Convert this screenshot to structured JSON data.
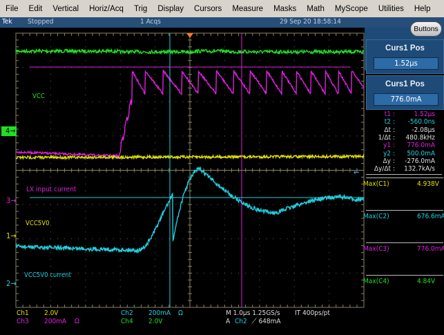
{
  "menu": [
    "File",
    "Edit",
    "Vertical",
    "Horiz/Acq",
    "Trig",
    "Display",
    "Cursors",
    "Measure",
    "Masks",
    "Math",
    "MyScope",
    "Utilities",
    "Help"
  ],
  "status": {
    "brand": "Tek",
    "state": "Stopped",
    "acqs": "1 Acqs",
    "datetime": "29 Sep 20 18:58:14"
  },
  "buttons_label": "Buttons",
  "cursor_panels": [
    {
      "title": "Curs1 Pos",
      "value": "1.52µs"
    },
    {
      "title": "Curs1 Pos",
      "value": "776.0mA"
    }
  ],
  "readouts": [
    {
      "key": "t1",
      "value": "1.52µs",
      "color": "#e020e0"
    },
    {
      "key": "t2",
      "value": "-560.0ns",
      "color": "#20d0e0"
    },
    {
      "key": "Δt",
      "value": "-2.08µs",
      "color": "#e0e0e0"
    },
    {
      "key": "1/Δt",
      "value": "480.8kHz",
      "color": "#e0e0e0"
    },
    {
      "key": "y1",
      "value": "776.0mA",
      "color": "#e020e0"
    },
    {
      "key": "y2",
      "value": "500.0mA",
      "color": "#20d0e0"
    },
    {
      "key": "Δy",
      "value": "-276.0mA",
      "color": "#e0e0e0"
    },
    {
      "key": "Δy/Δt",
      "value": "132.7kA/s",
      "color": "#e0e0e0"
    }
  ],
  "measurements": [
    {
      "label": "Max(C1)",
      "value": "4.938V",
      "color": "#e0e000"
    },
    {
      "label": "Max(C2)",
      "value": "676.6mA",
      "color": "#20d0e0"
    },
    {
      "label": "Max(C3)",
      "value": "776.0mA",
      "color": "#e020e0"
    },
    {
      "label": "Max(C4)",
      "value": "4.84V",
      "color": "#20e020"
    }
  ],
  "trace_labels": {
    "vcc": "VCC",
    "lx": "LX input current",
    "vcc5v0": "VCC5V0",
    "vcc5v0_current": "VCC5V0 current"
  },
  "channel_markers": {
    "ch4": "4",
    "ch3": "3",
    "ch1": "1",
    "ch2": "2"
  },
  "channels": {
    "ch1": {
      "name": "Ch1",
      "scale": "2.0V",
      "color": "#e0e000"
    },
    "ch2": {
      "name": "Ch2",
      "scale": "200mA",
      "ohm": "Ω",
      "color": "#20d0e0"
    },
    "ch3": {
      "name": "Ch3",
      "scale": "200mA",
      "ohm": "Ω",
      "color": "#e020e0"
    },
    "ch4": {
      "name": "Ch4",
      "scale": "2.0V",
      "color": "#20e020"
    }
  },
  "horizontal": {
    "timebase": "M 1.0µs 1.25GS/s",
    "interp": "IT 400ps/pt"
  },
  "trigger": {
    "prefix": "A",
    "source": "Ch2",
    "slope": "⟋",
    "level": "648mA"
  }
}
